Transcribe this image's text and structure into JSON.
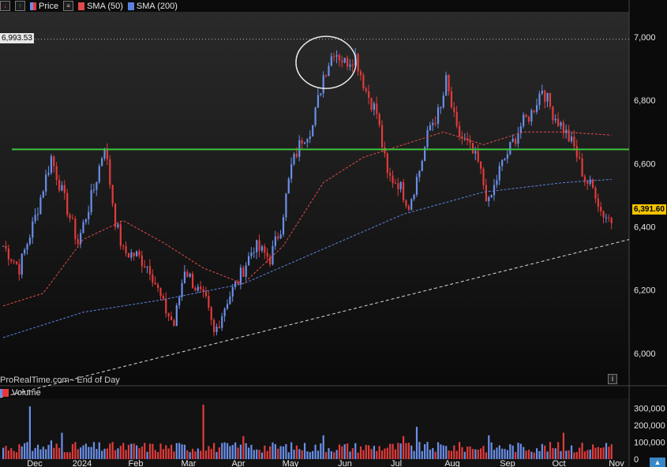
{
  "legend": {
    "price_label": "Price",
    "sma50_label": "SMA (50)",
    "sma200_label": "SMA (200)"
  },
  "volume_label": "Volume",
  "brand": "ProRealTime.com - End of Day",
  "info_label": "i",
  "high_tag": "6,993.53",
  "last_tag": "6,391.60",
  "colors": {
    "background": "#0b0b0b",
    "up": "#6a8fe8",
    "down": "#e23b3b",
    "sma50": "#e24a4a",
    "sma200": "#5b82e0",
    "resistance": "#3ec43e",
    "trendline": "#d9d9d9",
    "last_tag": "#f2c300"
  },
  "icons": [
    "down-arrow-icon",
    "up-arrow-icon",
    "price-series-icon",
    "settings-icon",
    "info-icon"
  ],
  "chart_data": [
    {
      "type": "candlestick",
      "title": "",
      "x_tick_labels": [
        "Dec",
        "2024",
        "Feb",
        "Mar",
        "Apr",
        "May",
        "Jun",
        "Jul",
        "Aug",
        "Sep",
        "Oct",
        "Nov"
      ],
      "y_tick_labels": [
        "6,000",
        "6,200",
        "6,400",
        "6,600",
        "6,800",
        "7,000"
      ],
      "ylim": [
        5900,
        7080
      ],
      "grid": false,
      "series": [
        {
          "name": "Price",
          "anchors": [
            [
              0,
              6340
            ],
            [
              6,
              6270
            ],
            [
              12,
              6430
            ],
            [
              18,
              6620
            ],
            [
              22,
              6510
            ],
            [
              28,
              6350
            ],
            [
              34,
              6520
            ],
            [
              38,
              6660
            ],
            [
              42,
              6420
            ],
            [
              45,
              6320
            ],
            [
              50,
              6310
            ],
            [
              55,
              6270
            ],
            [
              60,
              6150
            ],
            [
              64,
              6090
            ],
            [
              68,
              6270
            ],
            [
              72,
              6210
            ],
            [
              76,
              6160
            ],
            [
              79,
              6060
            ],
            [
              84,
              6170
            ],
            [
              88,
              6230
            ],
            [
              94,
              6340
            ],
            [
              100,
              6300
            ],
            [
              104,
              6400
            ],
            [
              108,
              6590
            ],
            [
              112,
              6680
            ],
            [
              116,
              6720
            ],
            [
              120,
              6880
            ],
            [
              124,
              6960
            ],
            [
              128,
              6920
            ],
            [
              132,
              6940
            ],
            [
              136,
              6830
            ],
            [
              140,
              6760
            ],
            [
              144,
              6560
            ],
            [
              148,
              6540
            ],
            [
              152,
              6470
            ],
            [
              156,
              6580
            ],
            [
              160,
              6720
            ],
            [
              164,
              6770
            ],
            [
              166,
              6860
            ],
            [
              170,
              6700
            ],
            [
              174,
              6660
            ],
            [
              178,
              6600
            ],
            [
              182,
              6470
            ],
            [
              186,
              6580
            ],
            [
              190,
              6650
            ],
            [
              194,
              6720
            ],
            [
              198,
              6760
            ],
            [
              202,
              6840
            ],
            [
              206,
              6760
            ],
            [
              210,
              6710
            ],
            [
              214,
              6650
            ],
            [
              218,
              6550
            ],
            [
              222,
              6510
            ],
            [
              224,
              6450
            ],
            [
              228,
              6420
            ]
          ]
        },
        {
          "name": "SMA (50)",
          "points": [
            [
              0,
              6150
            ],
            [
              15,
              6190
            ],
            [
              30,
              6360
            ],
            [
              45,
              6420
            ],
            [
              60,
              6350
            ],
            [
              75,
              6270
            ],
            [
              90,
              6220
            ],
            [
              105,
              6340
            ],
            [
              120,
              6540
            ],
            [
              135,
              6620
            ],
            [
              150,
              6660
            ],
            [
              165,
              6700
            ],
            [
              180,
              6660
            ],
            [
              195,
              6700
            ],
            [
              210,
              6700
            ],
            [
              228,
              6690
            ]
          ]
        },
        {
          "name": "SMA (200)",
          "points": [
            [
              0,
              6050
            ],
            [
              30,
              6130
            ],
            [
              60,
              6170
            ],
            [
              90,
              6220
            ],
            [
              120,
              6330
            ],
            [
              150,
              6440
            ],
            [
              180,
              6510
            ],
            [
              210,
              6540
            ],
            [
              228,
              6550
            ]
          ]
        },
        {
          "name": "Resistance",
          "points": [
            [
              0,
              6645
            ],
            [
              228,
              6645
            ]
          ]
        },
        {
          "name": "Trendline",
          "points": [
            [
              0,
              5860
            ],
            [
              228,
              6360
            ]
          ]
        }
      ],
      "annotations": {
        "circle_center": [
          121,
          6920
        ],
        "price_high": 6993.53,
        "last_price": 6391.6
      }
    },
    {
      "type": "bar",
      "title": "Volume",
      "y_tick_labels": [
        "0",
        "100,000",
        "200,000",
        "300,000"
      ],
      "ylim": [
        0,
        320000
      ],
      "spikes": [
        [
          10,
          310000
        ],
        [
          18,
          110000
        ],
        [
          22,
          155000
        ],
        [
          75,
          320000
        ],
        [
          90,
          135000
        ],
        [
          120,
          140000
        ],
        [
          150,
          135000
        ],
        [
          155,
          190000
        ],
        [
          182,
          140000
        ],
        [
          210,
          155000
        ],
        [
          226,
          95000
        ]
      ],
      "base_volume": 85000
    }
  ]
}
